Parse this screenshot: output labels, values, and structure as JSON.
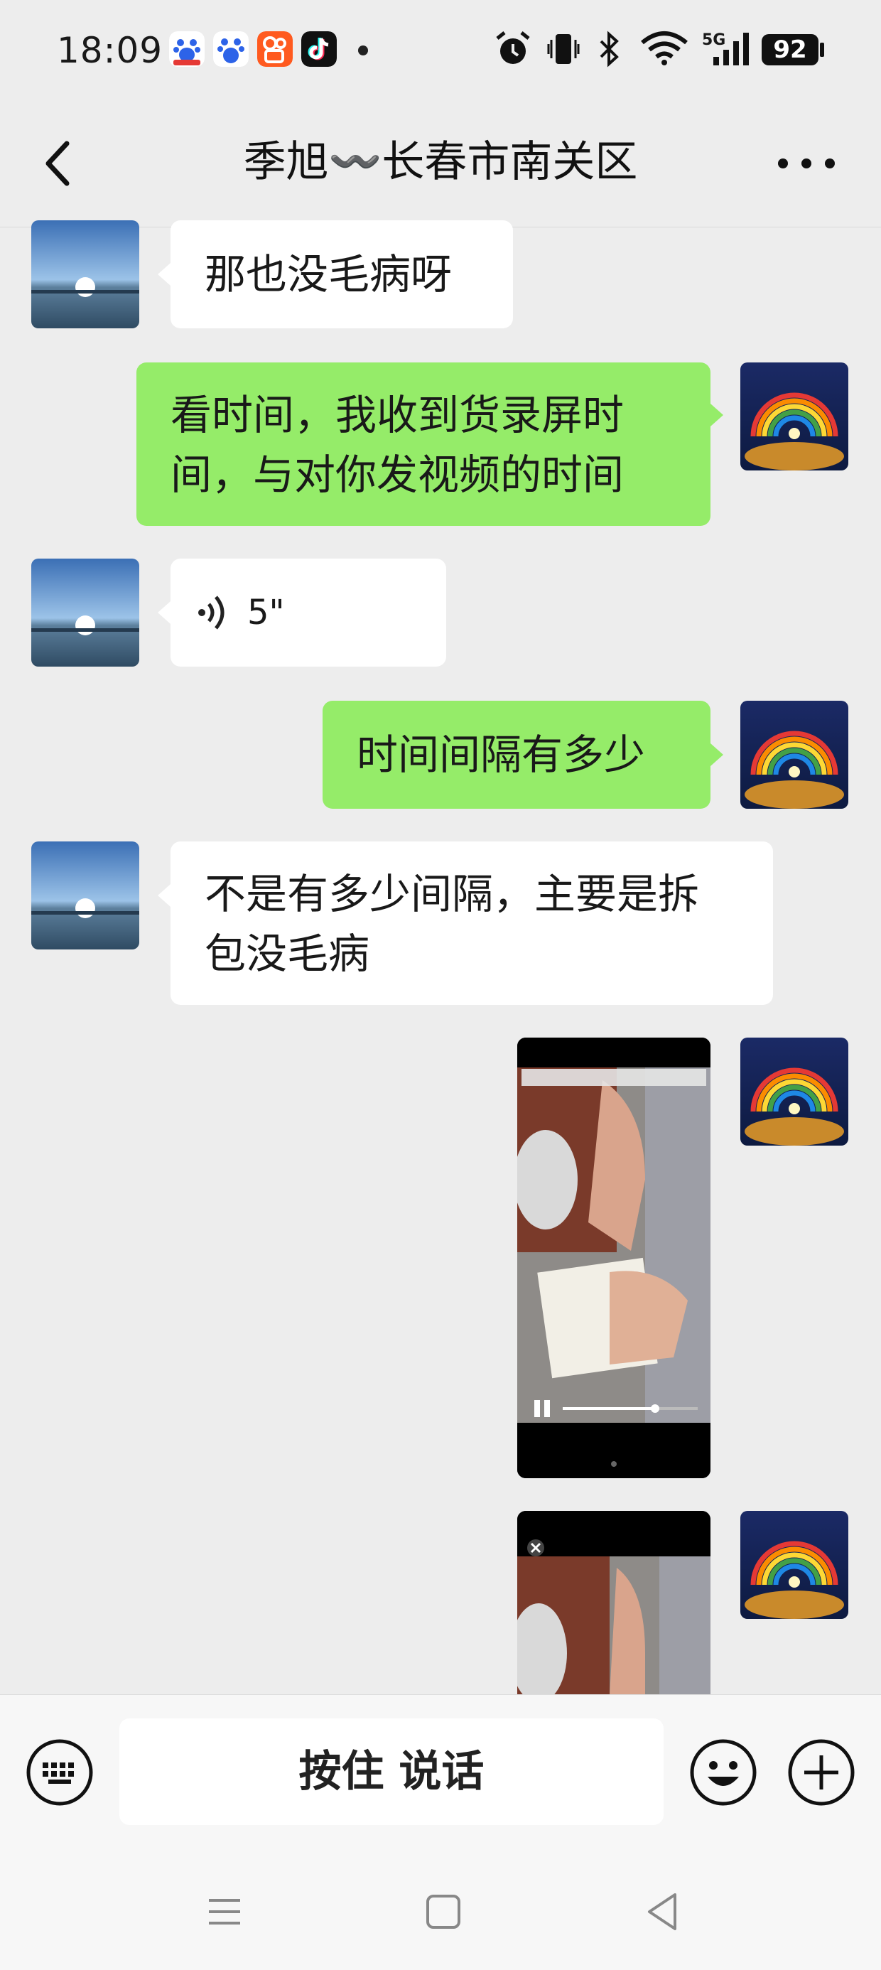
{
  "status_bar": {
    "time": "18:09",
    "battery": "92",
    "app_icons": [
      "baidu-app-icon",
      "baidu-app-icon",
      "kuaishou-app-icon",
      "tiktok-app-icon"
    ],
    "indicators": [
      "alarm-icon",
      "vibrate-icon",
      "bluetooth-icon",
      "wifi-icon",
      "signal-5g-icon"
    ],
    "signal_label": "5G"
  },
  "header": {
    "title": "季旭〰️长春市南关区",
    "back_icon": "chevron-left-icon",
    "more_icon": "more-dots-icon"
  },
  "messages": [
    {
      "side": "in",
      "type": "text",
      "text": "那也没毛病呀"
    },
    {
      "side": "out",
      "type": "text",
      "lines": [
        "看时间，我收到货录屏时",
        "间，与对你发视频的时间"
      ]
    },
    {
      "side": "in",
      "type": "voice",
      "duration": "5\""
    },
    {
      "side": "out",
      "type": "text",
      "text": "时间间隔有多少"
    },
    {
      "side": "in",
      "type": "text",
      "lines": [
        "不是有多少间隔，主要是拆",
        "包没毛病"
      ]
    },
    {
      "side": "out",
      "type": "video"
    },
    {
      "side": "out",
      "type": "video"
    }
  ],
  "input_bar": {
    "hold_to_talk": "按住 说话",
    "keyboard_icon": "keyboard-icon",
    "emoji_icon": "emoji-icon",
    "plus_icon": "plus-icon"
  },
  "colors": {
    "background": "#ededed",
    "outgoing_bubble": "#95ec69",
    "incoming_bubble": "#ffffff"
  }
}
